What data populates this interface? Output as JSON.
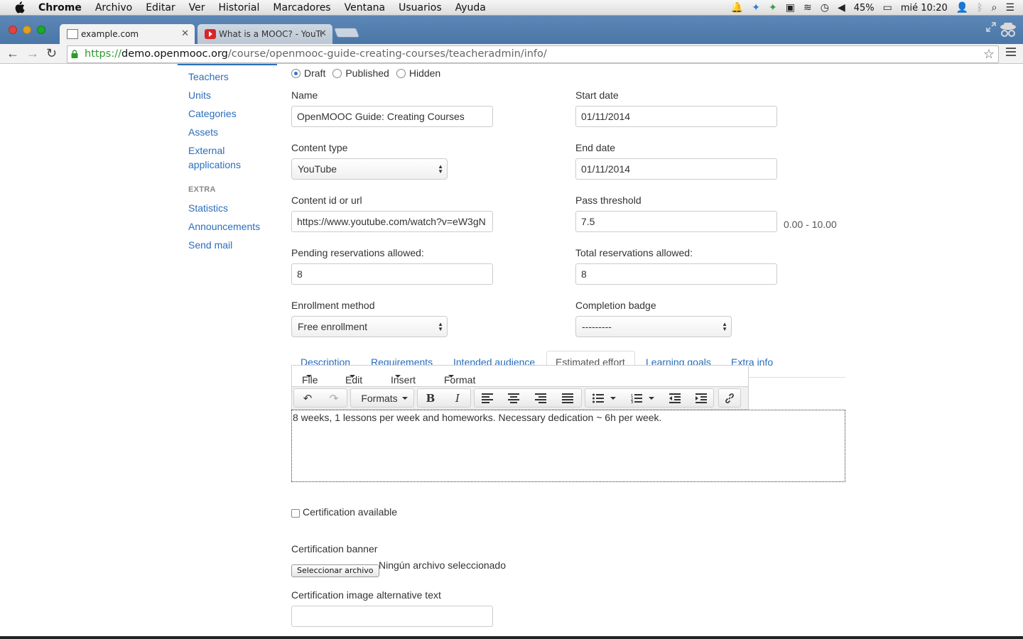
{
  "os_menubar": {
    "app": "Chrome",
    "menus": [
      "Archivo",
      "Editar",
      "Ver",
      "Historial",
      "Marcadores",
      "Ventana",
      "Usuarios",
      "Ayuda"
    ],
    "battery": "45%",
    "clock": "mié 10:20"
  },
  "browser": {
    "tabs": [
      {
        "title": "example.com",
        "active": true
      },
      {
        "title": "What is a MOOC? - YouTul",
        "active": false
      }
    ],
    "url_scheme": "https://",
    "url_host": "demo.openmooc.org",
    "url_path": "/course/openmooc-guide-creating-courses/teacheradmin/info/"
  },
  "sidebar": {
    "items": [
      "Teachers",
      "Units",
      "Categories",
      "Assets",
      "External",
      "applications"
    ],
    "extra_heading": "EXTRA",
    "extra_items": [
      "Statistics",
      "Announcements",
      "Send mail"
    ]
  },
  "status": {
    "options": [
      "Draft",
      "Published",
      "Hidden"
    ],
    "selected": "Draft"
  },
  "form": {
    "name_label": "Name",
    "name_value": "OpenMOOC Guide: Creating Courses",
    "start_label": "Start date",
    "start_value": "01/11/2014",
    "content_type_label": "Content type",
    "content_type_value": "YouTube",
    "end_label": "End date",
    "end_value": "01/11/2014",
    "content_id_label": "Content id or url",
    "content_id_value": "https://www.youtube.com/watch?v=eW3gN",
    "pass_label": "Pass threshold",
    "pass_value": "7.5",
    "pass_hint": "0.00 - 10.00",
    "pending_label": "Pending reservations allowed:",
    "pending_value": "8",
    "total_label": "Total reservations allowed:",
    "total_value": "8",
    "enrollment_label": "Enrollment method",
    "enrollment_value": "Free enrollment",
    "badge_label": "Completion badge",
    "badge_value": "---------"
  },
  "content_tabs": [
    "Description",
    "Requirements",
    "Intended audience",
    "Estimated effort",
    "Learning goals",
    "Extra info"
  ],
  "active_tab": "Estimated effort",
  "editor": {
    "menus": [
      "File",
      "Edit",
      "Insert",
      "Format"
    ],
    "formats_label": "Formats",
    "content": "8 weeks, 1 lessons per week and homeworks. Necessary dedication ~ 6h per week."
  },
  "certification": {
    "available_label": "Certification available",
    "banner_label": "Certification banner",
    "file_button": "Seleccionar archivo",
    "file_status": "Ningún archivo seleccionado",
    "alt_label": "Certification image alternative text",
    "alt_value": ""
  }
}
